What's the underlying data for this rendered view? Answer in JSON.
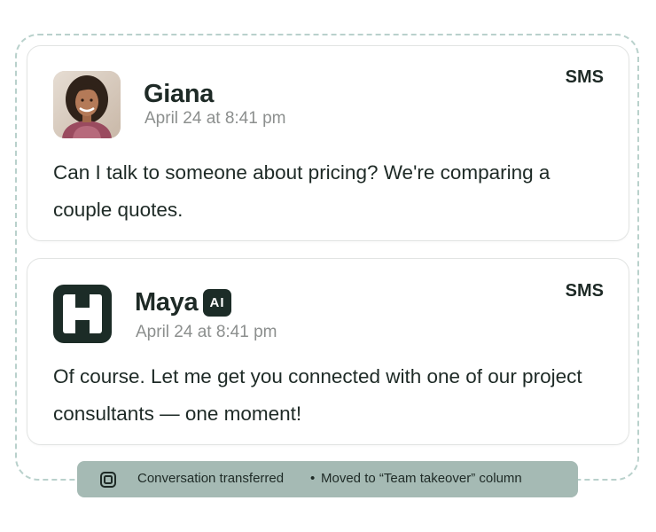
{
  "messages": [
    {
      "sender": "Giana",
      "avatar": "customer-photo",
      "timestamp": "April 24 at 8:41 pm",
      "channel": "SMS",
      "text": "Can I talk to someone about pricing? We're comparing a couple quotes."
    },
    {
      "sender": "Maya",
      "avatar": "h-logo-icon",
      "badge": "AI",
      "timestamp": "April 24 at 8:41 pm",
      "channel": "SMS",
      "text": "Of course. Let me get you connected with one of our project consultants — one moment!"
    }
  ],
  "status": {
    "icon": "transfer-icon",
    "text": "Conversation transferred",
    "separator": "•",
    "detail": "Moved to “Team takeover” column"
  },
  "colors": {
    "dark": "#1c2c27",
    "muted_text": "#8c8f8e",
    "pill_bg": "#a5bab4",
    "dashed_border": "#b9d1cc"
  }
}
